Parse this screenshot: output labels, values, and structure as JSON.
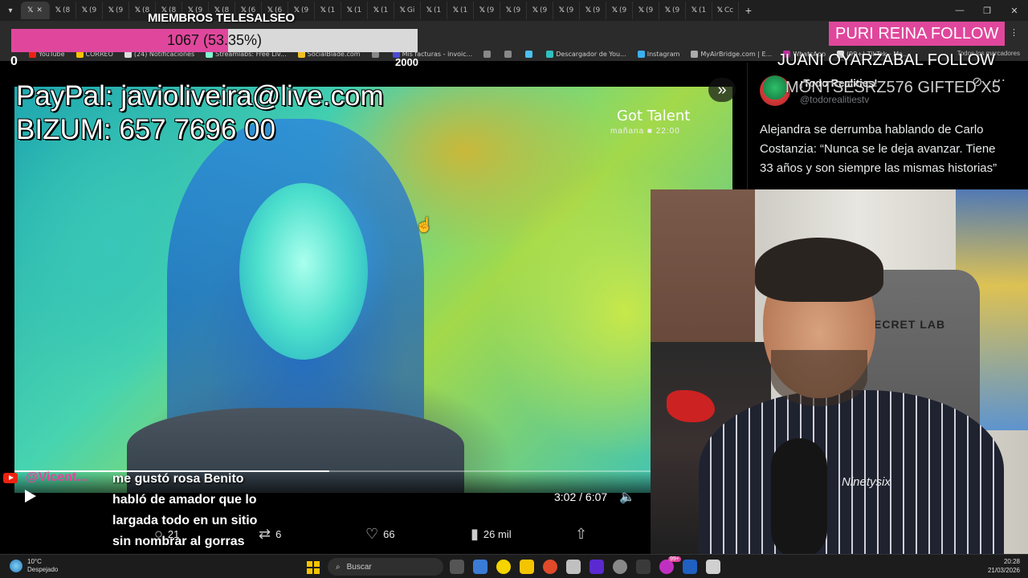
{
  "browser": {
    "tabs": [
      {
        "label": "",
        "active": true
      },
      {
        "label": "(8"
      },
      {
        "label": "(9"
      },
      {
        "label": "(9"
      },
      {
        "label": "(8"
      },
      {
        "label": "(8"
      },
      {
        "label": "(9"
      },
      {
        "label": "(8"
      },
      {
        "label": "(6"
      },
      {
        "label": "(6"
      },
      {
        "label": "(9"
      },
      {
        "label": "(1"
      },
      {
        "label": "(1"
      },
      {
        "label": "(1"
      },
      {
        "label": "Gi"
      },
      {
        "label": "(1"
      },
      {
        "label": "(1"
      },
      {
        "label": "(9"
      },
      {
        "label": "(9"
      },
      {
        "label": "(9"
      },
      {
        "label": "(9"
      },
      {
        "label": "(9"
      },
      {
        "label": "(9"
      },
      {
        "label": "(9"
      },
      {
        "label": "(9"
      },
      {
        "label": "(1"
      },
      {
        "label": "Cc"
      }
    ],
    "bookmarks": [
      {
        "label": "YouTube",
        "color": "#e21"
      },
      {
        "label": "CORREO",
        "color": "#f5c400"
      },
      {
        "label": "(24) Notificaciones",
        "color": "#ddd"
      },
      {
        "label": "Streamlabs: Free Liv...",
        "color": "#80f5d2"
      },
      {
        "label": "SocialBlade.com",
        "color": "#f0c020"
      },
      {
        "label": "",
        "color": "#888"
      },
      {
        "label": "Mis facturas - invoic...",
        "color": "#4a4ad0"
      },
      {
        "label": "",
        "color": "#888"
      },
      {
        "label": "",
        "color": "#888"
      },
      {
        "label": "",
        "color": "#4ac0f0"
      },
      {
        "label": "Descargador de You...",
        "color": "#30c0c0"
      },
      {
        "label": "Instagram",
        "color": "#3ab0f0"
      },
      {
        "label": "MyAirBridge.com | E...",
        "color": "#aaa"
      },
      {
        "label": "WhatsApp",
        "color": "#c030a0"
      },
      {
        "label": "(99+) TikTok - Ma...",
        "color": "#ddd"
      }
    ],
    "bookmarks_right": "Todos los marcadores"
  },
  "goal": {
    "title": "MIEMBROS TELESALSEO",
    "current": "1067 (53.35%)",
    "progress": 0.5335,
    "min": "0",
    "max": "2000",
    "fill_color": "#e0479c"
  },
  "paypal": {
    "line1": "PayPal: javioliveira@live.com",
    "line2": "BIZUM: 657 7696 00"
  },
  "video": {
    "logo": "Got Talent",
    "logo_sub": "mañana  ■  22:00",
    "time": "3:02 / 6:07",
    "progress": 0.495
  },
  "tweet": {
    "account_name": "¡Todo Realities!",
    "handle": "@todorealitiestv",
    "text": "Alejandra se derrumba hablando de Carlo Costanzia: “Nunca se le deja avanzar. Tiene 33 años y son siempre las mismas historias”",
    "actions": {
      "replies": "21",
      "reposts": "6",
      "likes": "66",
      "views": "26 mil"
    }
  },
  "stream": {
    "follow1": "PURI REINA  FOLLOW",
    "follow2": "JUANI OYARZABAL  FOLLOW",
    "follow3": "MONTSESRZ576  GIFTED X5",
    "chair_logo": "ECRET LAB",
    "sweater": "Ninetysix"
  },
  "chat": {
    "user": "@Vicent...",
    "message": "me gustó rosa Benito habló de amador que lo largada todo en un sitio sin nombrar al gorras"
  },
  "taskbar": {
    "weather_temp": "10°C",
    "weather_desc": "Despejado",
    "search_placeholder": "Buscar",
    "time": "20:28",
    "date": "21/03/2026",
    "badge": "99+"
  }
}
